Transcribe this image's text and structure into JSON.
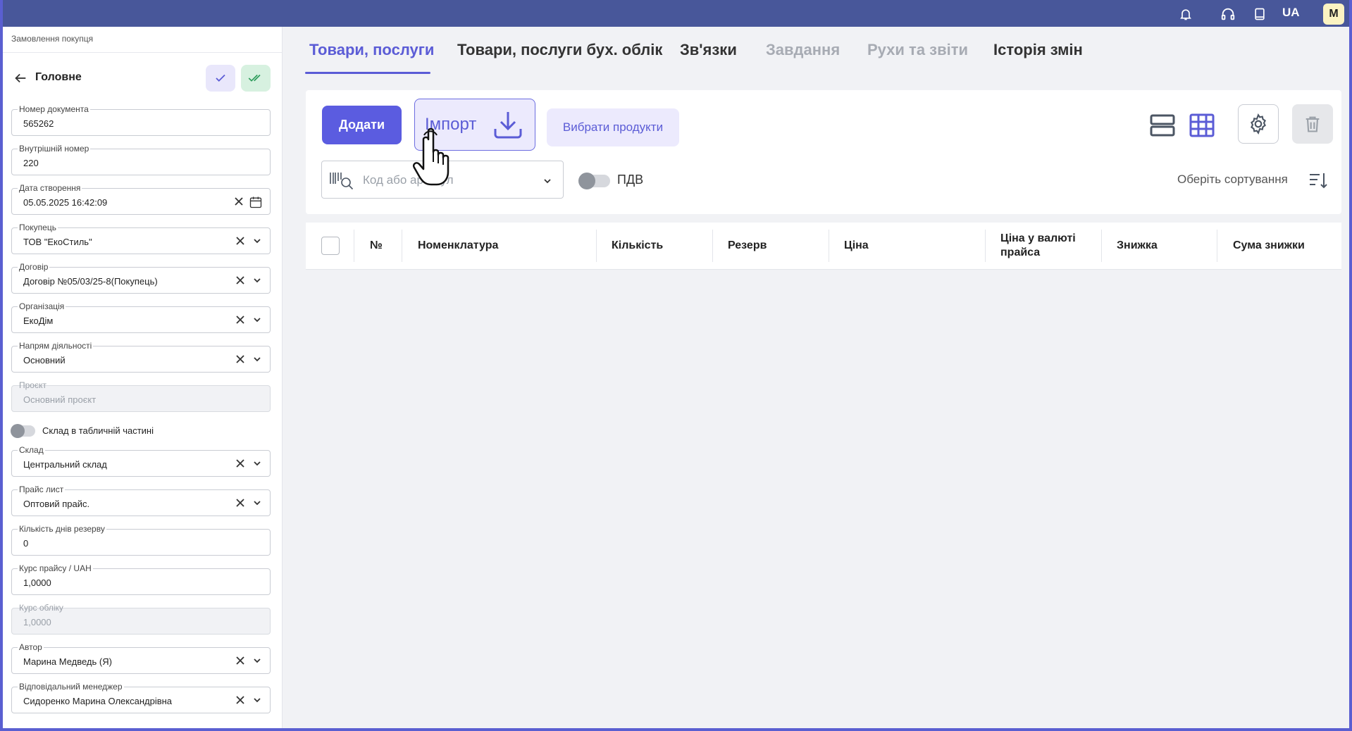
{
  "topbar": {
    "icons": [
      "bell-icon",
      "headset-icon",
      "book-icon"
    ],
    "lang": "UA",
    "avatar_initial": "M"
  },
  "sidebar": {
    "doc_type": "Замовлення покупця",
    "section_title": "Головне",
    "fields": {
      "doc_number": {
        "label": "Номер документа",
        "value": "565262"
      },
      "internal_number": {
        "label": "Внутрішній номер",
        "value": "220"
      },
      "created_at": {
        "label": "Дата створення",
        "value": "05.05.2025 16:42:09"
      },
      "buyer": {
        "label": "Покупець",
        "value": "ТОВ \"ЕкоСтиль\""
      },
      "contract": {
        "label": "Договір",
        "value": "Договір №05/03/25-8(Покупець)"
      },
      "organization": {
        "label": "Організація",
        "value": "ЕкоДім"
      },
      "activity": {
        "label": "Напрям діяльності",
        "value": "Основний"
      },
      "project": {
        "label": "Проєкт",
        "value": "Основний проєкт"
      },
      "warehouse": {
        "label": "Склад",
        "value": "Центральний склад"
      },
      "price_list": {
        "label": "Прайс лист",
        "value": "Оптовий прайс."
      },
      "reserve_days": {
        "label": "Кількість днів резерву",
        "value": "0"
      },
      "price_rate": {
        "label": "Курс прайсу / UAH",
        "value": "1,0000"
      },
      "accounting_rate": {
        "label": "Курс обліку",
        "value": "1,0000"
      },
      "author": {
        "label": "Автор",
        "value": "Марина Медведь (Я)"
      },
      "manager": {
        "label": "Відповідальний менеджер",
        "value": "Сидоренко Марина Олександрівна"
      }
    },
    "toggle_warehouse_in_table": {
      "label": "Склад в табличній частині",
      "on": false
    }
  },
  "tabs": [
    {
      "label": "Товари, послуги",
      "state": "active"
    },
    {
      "label": "Товари, послуги бух. облік",
      "state": "normal"
    },
    {
      "label": "Зв'язки",
      "state": "normal"
    },
    {
      "label": "Завдання",
      "state": "disabled"
    },
    {
      "label": "Рухи та звіти",
      "state": "disabled"
    },
    {
      "label": "Історія змін",
      "state": "normal"
    }
  ],
  "toolbar": {
    "add_label": "Додати",
    "import_label": "Імпорт",
    "choose_products_label": "Вибрати продукти",
    "search_placeholder": "Код або артикул",
    "vat_label": "ПДВ",
    "vat_on": false,
    "sort_label": "Оберіть сортування"
  },
  "table": {
    "columns": [
      "№",
      "Номенклатура",
      "Кількість",
      "Резерв",
      "Ціна",
      "Ціна у валюті прайса",
      "Знижка",
      "Сума знижки"
    ],
    "rows": []
  },
  "colors": {
    "accent": "#5b5cd6",
    "topbar": "#48579a",
    "success_bg": "#d7f1e0",
    "success": "#2e9d5c"
  }
}
